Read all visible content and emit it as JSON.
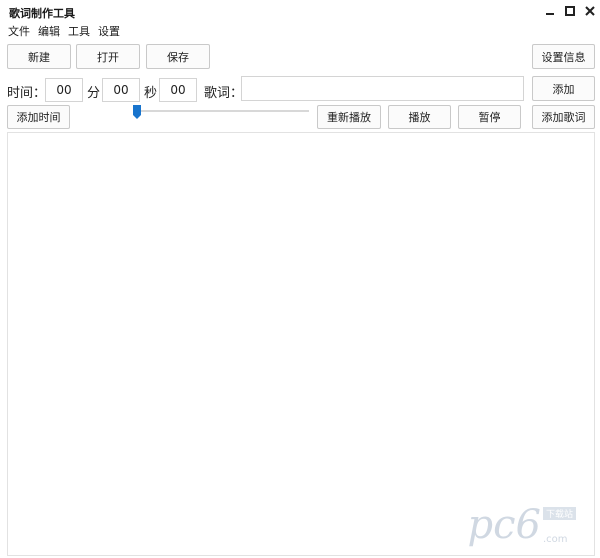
{
  "window": {
    "title": "歌词制作工具",
    "controls": {
      "minimize": "minimize-icon",
      "maximize": "maximize-icon",
      "close": "close-icon"
    }
  },
  "menu": [
    "文件",
    "编辑",
    "工具",
    "设置"
  ],
  "toolbar": {
    "new_label": "新建",
    "open_label": "打开",
    "save_label": "保存",
    "settings_label": "设置信息"
  },
  "time": {
    "label": "时间：",
    "minutes_value": "00",
    "minutes_unit": "分",
    "seconds_value": "00",
    "seconds_unit": "秒",
    "millis_value": "00"
  },
  "lyric": {
    "label": "歌词：",
    "value": "",
    "add_label": "添加"
  },
  "actions": {
    "add_time_label": "添加时间",
    "replay_label": "重新播放",
    "play_label": "播放",
    "pause_label": "暂停",
    "add_lyric_label": "添加歌词"
  },
  "progress": {
    "position": 0
  },
  "watermark": {
    "brand": "pc6",
    "badge": "下载站",
    "domain": ".com"
  },
  "colors": {
    "accent": "#1874cd",
    "border": "#c9c9c9"
  }
}
